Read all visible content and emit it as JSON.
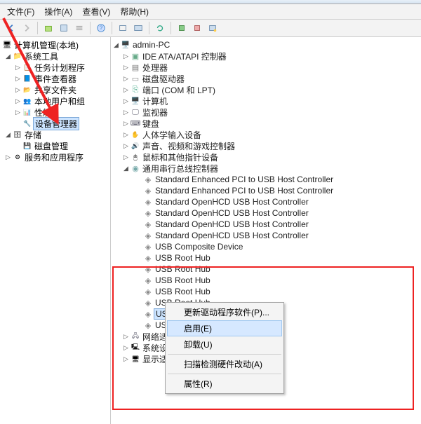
{
  "menubar": {
    "file": "文件(F)",
    "action": "操作(A)",
    "view": "查看(V)",
    "help": "帮助(H)"
  },
  "left_tree": {
    "root": "计算机管理(本地)",
    "sys_tools": "系统工具",
    "sys_tools_children": [
      {
        "label": "任务计划程序",
        "tw": "▷",
        "cls": "ig-schedule"
      },
      {
        "label": "事件查看器",
        "tw": "▷",
        "cls": "ig-event"
      },
      {
        "label": "共享文件夹",
        "tw": "▷",
        "cls": "ig-share"
      },
      {
        "label": "本地用户和组",
        "tw": "▷",
        "cls": "ig-users"
      },
      {
        "label": "性能",
        "tw": "▷",
        "cls": "ig-perf"
      },
      {
        "label": "设备管理器",
        "tw": "",
        "cls": "ig-devmgr",
        "selected": true
      }
    ],
    "storage": "存储",
    "storage_children": [
      {
        "label": "磁盘管理",
        "tw": "",
        "cls": "ig-diskmgmt"
      }
    ],
    "services": "服务和应用程序"
  },
  "right_tree": {
    "root": "admin-PC",
    "categories": [
      {
        "tw": "▷",
        "cls": "ig-chip",
        "label": "IDE ATA/ATAPI 控制器"
      },
      {
        "tw": "▷",
        "cls": "ig-cpu",
        "label": "处理器"
      },
      {
        "tw": "▷",
        "cls": "ig-drive",
        "label": "磁盘驱动器"
      },
      {
        "tw": "▷",
        "cls": "ig-port",
        "label": "端口 (COM 和 LPT)"
      },
      {
        "tw": "▷",
        "cls": "ig-computer",
        "label": "计算机"
      },
      {
        "tw": "▷",
        "cls": "ig-monitor",
        "label": "监视器"
      },
      {
        "tw": "▷",
        "cls": "ig-kb",
        "label": "键盘"
      },
      {
        "tw": "▷",
        "cls": "ig-hid",
        "label": "人体学输入设备"
      },
      {
        "tw": "▷",
        "cls": "ig-sound",
        "label": "声音、视频和游戏控制器"
      },
      {
        "tw": "▷",
        "cls": "ig-mouse",
        "label": "鼠标和其他指针设备"
      }
    ],
    "usb_title": "通用串行总线控制器",
    "usb_items": [
      "Standard Enhanced PCI to USB Host Controller",
      "Standard Enhanced PCI to USB Host Controller",
      "Standard OpenHCD USB Host Controller",
      "Standard OpenHCD USB Host Controller",
      "Standard OpenHCD USB Host Controller",
      "Standard OpenHCD USB Host Controller",
      "USB Composite Device",
      "USB Root Hub",
      "USB Root Hub",
      "USB Root Hub",
      "USB Root Hub",
      "USB Root Hub",
      "USB R",
      "USB R"
    ],
    "tail": [
      {
        "tw": "▷",
        "cls": "ig-net",
        "label": "网络适配"
      },
      {
        "tw": "▷",
        "cls": "ig-sys",
        "label": "系统设备"
      },
      {
        "tw": "▷",
        "cls": "ig-display",
        "label": "显示适配"
      }
    ]
  },
  "context_menu": {
    "update": "更新驱动程序软件(P)...",
    "enable": "启用(E)",
    "uninstall": "卸载(U)",
    "scan": "扫描检测硬件改动(A)",
    "props": "属性(R)"
  }
}
